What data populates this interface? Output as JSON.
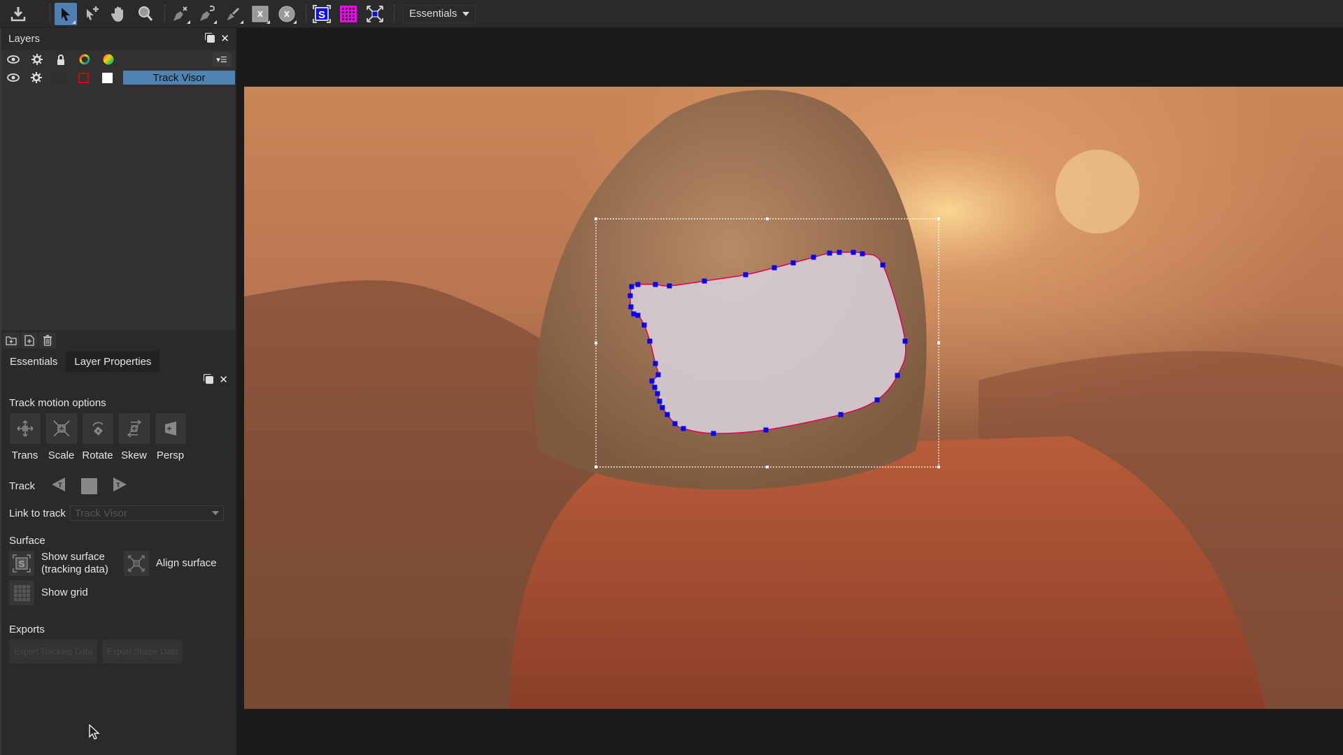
{
  "toolbar": {
    "tools": [
      {
        "name": "import",
        "icon": "download-icon"
      },
      {
        "name": "select",
        "icon": "arrow-pointer-icon",
        "active": true
      },
      {
        "name": "add-point",
        "icon": "add-point-icon"
      },
      {
        "name": "pan",
        "icon": "hand-icon"
      },
      {
        "name": "zoom",
        "icon": "magnifier-icon"
      },
      {
        "name": "create-xspline",
        "icon": "pen-x-icon"
      },
      {
        "name": "create-bspline",
        "icon": "pen-b-icon"
      },
      {
        "name": "brush",
        "icon": "brush-icon"
      },
      {
        "name": "rectangle-x",
        "icon": "square-x-icon"
      },
      {
        "name": "ellipse-x",
        "icon": "circle-x-icon"
      },
      {
        "name": "show-surface",
        "icon": "surface-s-icon"
      },
      {
        "name": "show-grid",
        "icon": "grid-icon"
      },
      {
        "name": "align-surface",
        "icon": "align-surface-icon"
      }
    ],
    "workspace": "Essentials"
  },
  "layers_panel": {
    "title": "Layers",
    "header_icons": [
      "eye-icon",
      "gear-icon",
      "lock-icon",
      "color-ring-icon",
      "color-wheel-icon"
    ],
    "layers": [
      {
        "name": "Track Visor",
        "visible": true,
        "color": "#e00000",
        "fill": "#ffffff",
        "selected": true
      }
    ]
  },
  "tabs": [
    {
      "label": "Essentials",
      "selected": false
    },
    {
      "label": "Layer Properties",
      "selected": true
    }
  ],
  "properties": {
    "track_motion_label": "Track motion options",
    "motion_options": [
      {
        "label": "Trans",
        "icon": "translate-icon"
      },
      {
        "label": "Scale",
        "icon": "scale-icon"
      },
      {
        "label": "Rotate",
        "icon": "rotate-icon"
      },
      {
        "label": "Skew",
        "icon": "skew-icon"
      },
      {
        "label": "Persp",
        "icon": "perspective-icon"
      }
    ],
    "track_label": "Track",
    "link_label": "Link to track",
    "link_value": "Track Visor",
    "surface_label": "Surface",
    "show_surface_line1": "Show surface",
    "show_surface_line2": "(tracking data)",
    "align_surface": "Align surface",
    "show_grid": "Show grid",
    "exports_label": "Exports",
    "export_tracking": "Export Tracking Data",
    "export_shape": "Export Shape Data"
  },
  "viewer": {
    "shape_color": "#e0005a",
    "point_color": "#0000ff"
  }
}
